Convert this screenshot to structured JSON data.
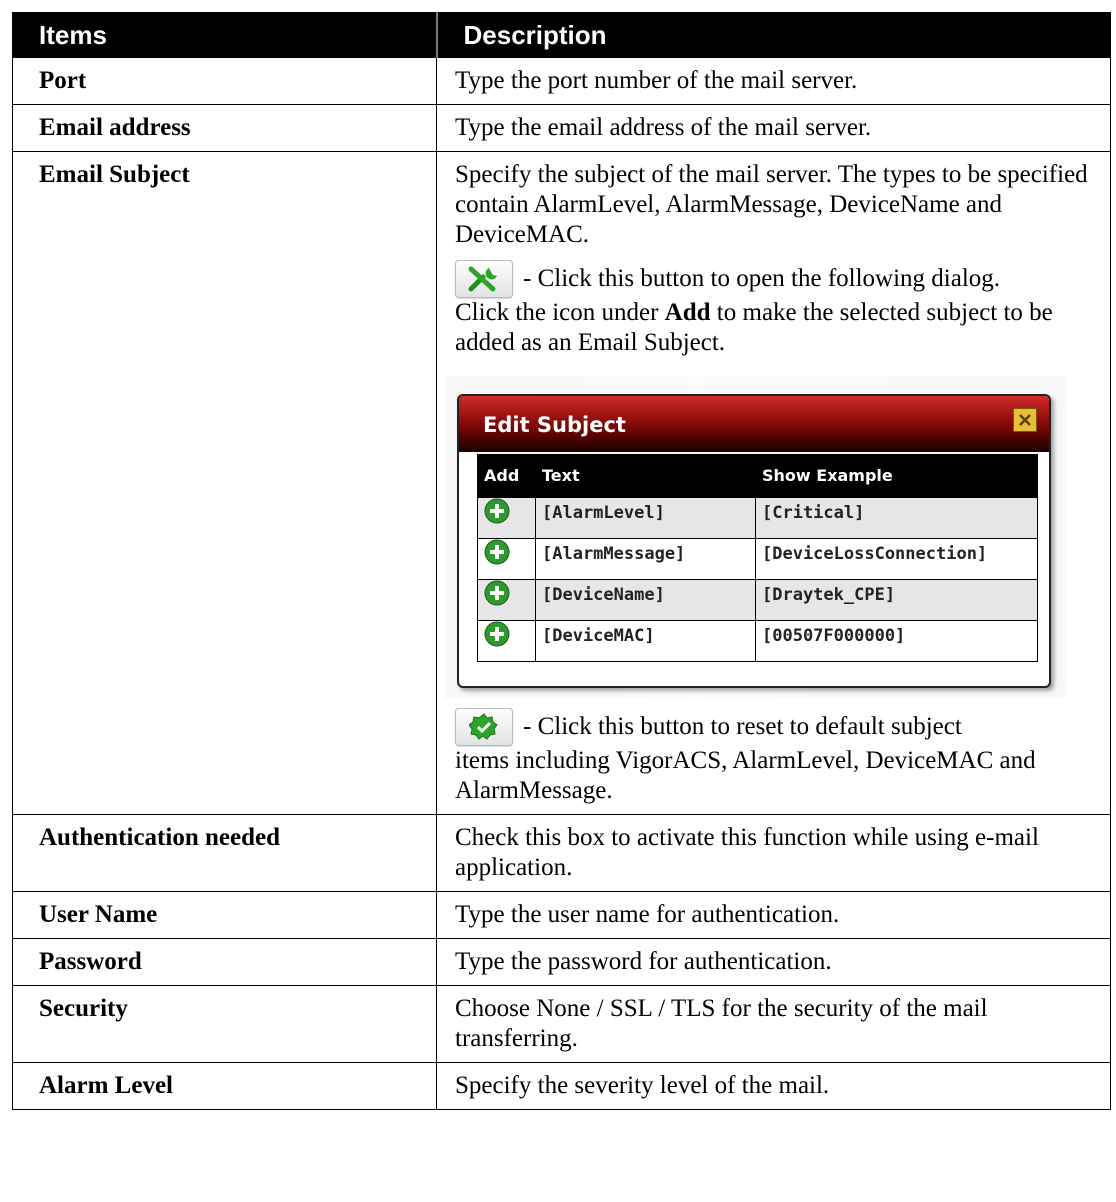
{
  "table": {
    "header_items": "Items",
    "header_description": "Description"
  },
  "rows": {
    "port": {
      "item": "Port",
      "desc": "Type the port number of the mail server."
    },
    "email_address": {
      "item": "Email address",
      "desc": "Type the email address of the mail server."
    },
    "email_subject": {
      "item": "Email Subject",
      "desc_intro": "Specify the subject of the mail server. The types to be specified contain AlarmLevel, AlarmMessage, DeviceName and DeviceMAC.",
      "edit_button_text": "- Click this button to open the following dialog.",
      "click_prefix": "Click the icon under ",
      "click_bold": "Add",
      "click_suffix": " to make the selected subject to be added as an Email Subject.",
      "reset_button_text": "- Click this button to reset to default subject",
      "reset_continuation": "items including VigorACS, AlarmLevel, DeviceMAC and AlarmMessage."
    },
    "authentication": {
      "item": "Authentication needed",
      "desc": "Check this box to activate this function while using e-mail application."
    },
    "user_name": {
      "item": "User Name",
      "desc": "Type the user name for authentication."
    },
    "password": {
      "item": "Password",
      "desc": "Type the password for authentication."
    },
    "security": {
      "item": "Security",
      "desc": "Choose None / SSL / TLS for the security of the mail transferring."
    },
    "alarm_level": {
      "item": "Alarm Level",
      "desc": "Specify the severity level of the mail."
    }
  },
  "dialog": {
    "title": "Edit Subject",
    "columns": [
      "Add",
      "Text",
      "Show Example"
    ],
    "entries": [
      {
        "text": "[AlarmLevel]",
        "example": "[Critical]"
      },
      {
        "text": "[AlarmMessage]",
        "example": "[DeviceLossConnection]"
      },
      {
        "text": "[DeviceName]",
        "example": "[Draytek_CPE]"
      },
      {
        "text": "[DeviceMAC]",
        "example": "[00507F000000]"
      }
    ]
  },
  "icons": {
    "edit_button": "tools-icon",
    "reset_button": "gear-check-icon",
    "add": "plus-circle-icon",
    "close": "close-icon"
  },
  "colors": {
    "header_bg": "#000000",
    "dialog_title_red": "#b01010",
    "add_green": "#2e9a2e"
  }
}
